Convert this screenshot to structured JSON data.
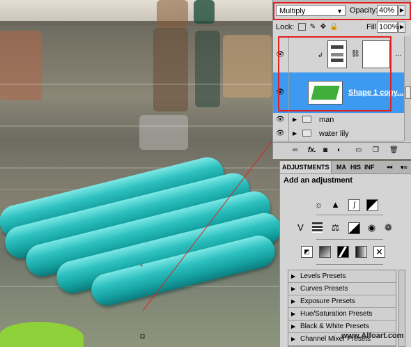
{
  "layers_panel": {
    "blend_mode": "Multiply",
    "opacity_label": "Opacity:",
    "opacity_value": "40%",
    "lock_label": "Lock:",
    "fill_label": "Fill:",
    "fill_value": "100%",
    "layers": [
      {
        "name": "",
        "type": "adjustment-layer"
      },
      {
        "name": "Shape 1 copy...",
        "type": "shape-layer",
        "selected": true
      },
      {
        "name": "man",
        "type": "group"
      },
      {
        "name": "water lily",
        "type": "group"
      }
    ],
    "footer_icons": [
      "link-icon",
      "fx-icon",
      "mask-icon",
      "adjustment-icon",
      "folder-icon",
      "new-layer-icon",
      "trash-icon"
    ]
  },
  "adjustments_panel": {
    "tabs": [
      "ADJUSTMENTS",
      "MA",
      "HIS",
      "INF"
    ],
    "title": "Add an adjustment",
    "icon_rows": [
      [
        "brightness-contrast-icon",
        "levels-icon",
        "curves-icon",
        "exposure-icon"
      ],
      [
        "vibrance-icon",
        "hue-saturation-icon",
        "color-balance-icon",
        "black-white-icon",
        "photo-filter-icon",
        "channel-mixer-icon"
      ],
      [
        "invert-icon",
        "posterize-icon",
        "threshold-icon",
        "gradient-map-icon",
        "selective-color-icon"
      ]
    ],
    "presets": [
      "Levels Presets",
      "Curves Presets",
      "Exposure Presets",
      "Hue/Saturation Presets",
      "Black & White Presets",
      "Channel Mixer Presets"
    ]
  },
  "watermark": "www.Alfoart.com",
  "colors": {
    "selection_blue": "#3d9af0",
    "highlight_red": "#e02020",
    "tube_teal": "#2fc2c0",
    "panel_gray": "#d4d4d4"
  }
}
